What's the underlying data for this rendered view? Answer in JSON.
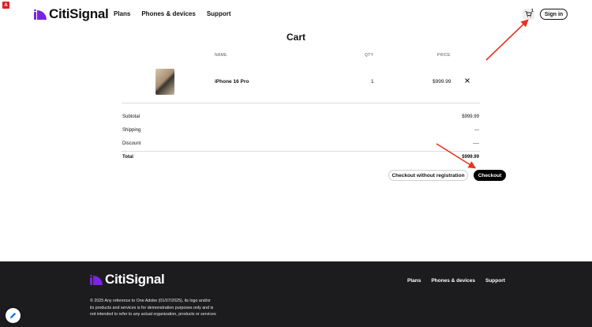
{
  "header": {
    "brand": "CitiSignal",
    "nav": [
      "Plans",
      "Phones & devices",
      "Support"
    ],
    "cart_count": "1",
    "signin_label": "Sign in"
  },
  "cart": {
    "title": "Cart",
    "columns": {
      "name": "NAME",
      "qty": "QTY",
      "price": "PRICE"
    },
    "items": [
      {
        "name": "iPhone 16 Pro",
        "qty": "1",
        "price": "$999.99"
      }
    ],
    "summary": {
      "subtotal_label": "Subtotal",
      "subtotal": "$999.99",
      "shipping_label": "Shipping",
      "shipping": "---",
      "discount_label": "Discount",
      "discount": "----",
      "total_label": "Total",
      "total": "$999.99"
    },
    "guest_checkout_label": "Checkout without registration",
    "checkout_label": "Checkout"
  },
  "footer": {
    "brand": "CitiSignal",
    "nav": [
      "Plans",
      "Phones & devices",
      "Support"
    ],
    "legal_lines": [
      "© 2025 Any reference to One Adobe (01/07/2025), its logo and/or",
      "its products and services is for demonstration purposes only and is",
      "not intended to refer to any actual organization, products or services"
    ]
  },
  "colors": {
    "brand_purple": "#7a24e0",
    "footer_bg": "#1c1c1e",
    "annotation_red": "#e8321e"
  }
}
